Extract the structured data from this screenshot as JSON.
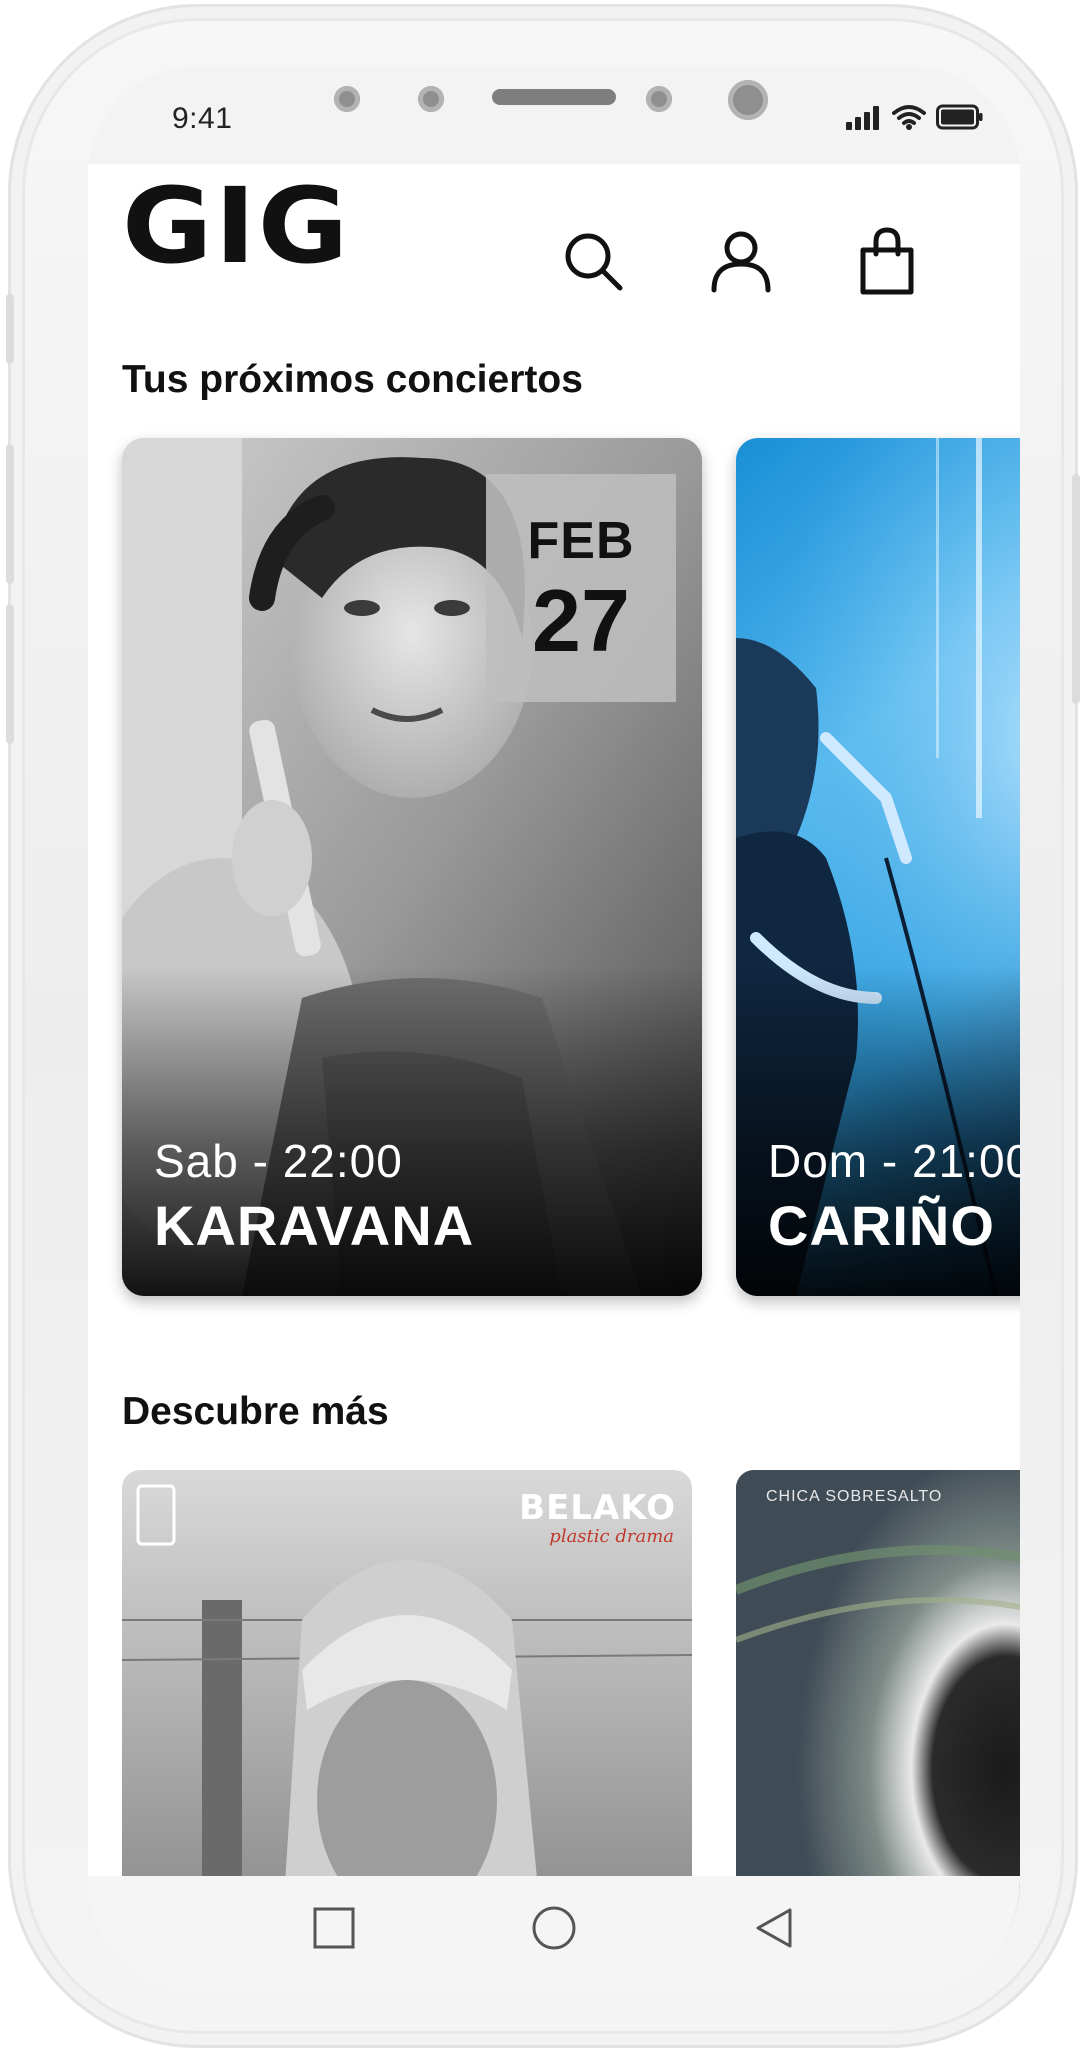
{
  "status_bar": {
    "time": "9:41"
  },
  "header": {
    "logo": "GIG",
    "icons": [
      "search-icon",
      "user-icon",
      "shopping-bag-icon"
    ]
  },
  "upcoming": {
    "title": "Tus próximos conciertos",
    "cards": [
      {
        "month": "FEB",
        "day": "27",
        "time": "Sab - 22:00",
        "artist": "KARAVANA"
      },
      {
        "time": "Dom - 21:00",
        "artist": "CARIÑO"
      }
    ]
  },
  "discover": {
    "title": "Descubre más",
    "albums": [
      {
        "artist": "BELAKO",
        "album": "plastic drama"
      },
      {
        "artist": "CHICA SOBRESALTO"
      }
    ]
  },
  "nav": {
    "icons": [
      "recents-square-icon",
      "home-circle-icon",
      "back-triangle-icon"
    ]
  },
  "colors": {
    "text": "#111111",
    "background": "#ffffff",
    "accent_blue": "#2fa6e6"
  }
}
